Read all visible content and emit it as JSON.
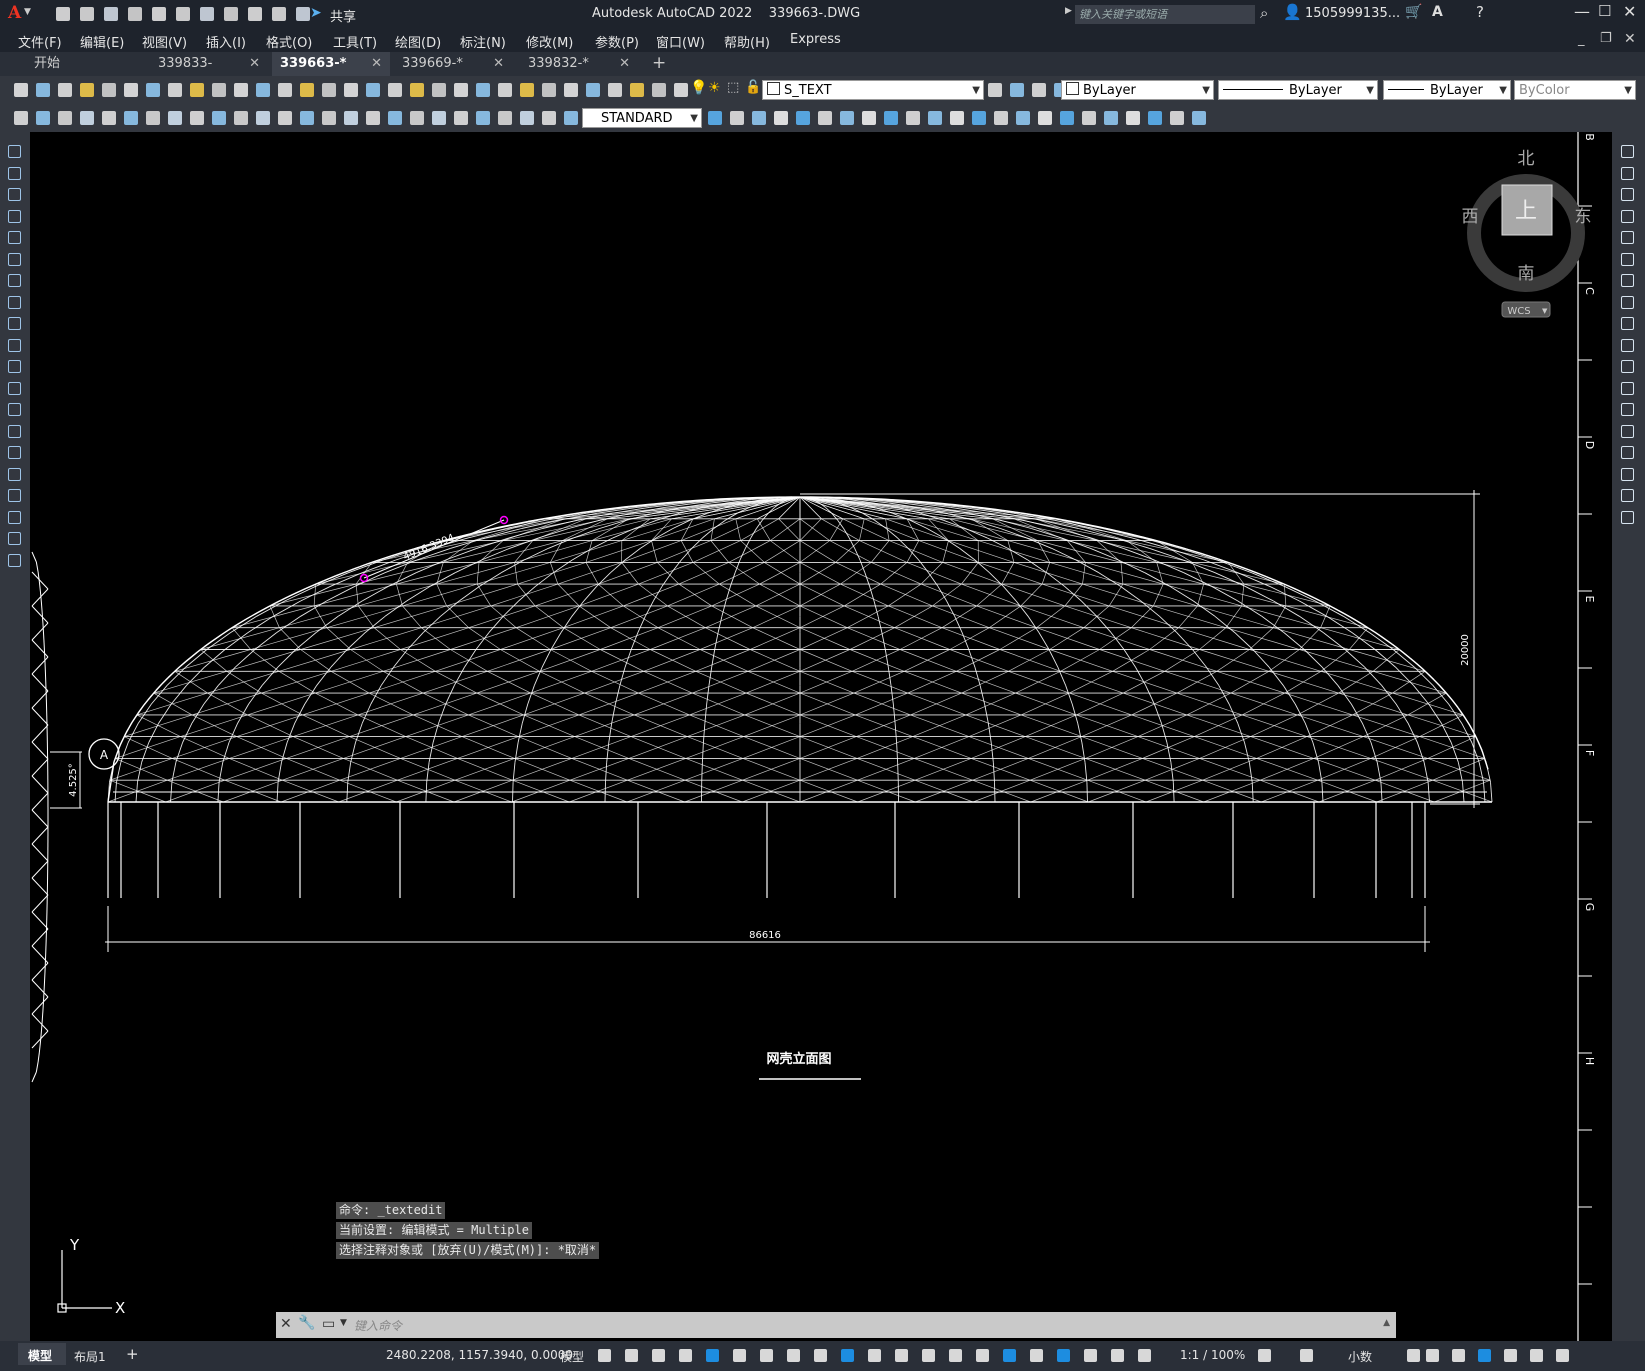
{
  "titlebar": {
    "app_logo": "A",
    "share_label": "共享",
    "title": "Autodesk AutoCAD 2022    339663-.DWG",
    "search_placeholder": "键入关键字或短语",
    "user": "1505999135...",
    "window_controls": [
      "minimize-icon",
      "restore-icon",
      "close-icon"
    ]
  },
  "menubar": {
    "items": [
      "文件(F)",
      "编辑(E)",
      "视图(V)",
      "插入(I)",
      "格式(O)",
      "工具(T)",
      "绘图(D)",
      "标注(N)",
      "修改(M)",
      "参数(P)",
      "窗口(W)",
      "帮助(H)",
      "Express"
    ]
  },
  "tabs": {
    "items": [
      {
        "label": "开始",
        "closable": false,
        "active": false
      },
      {
        "label": "339833-",
        "closable": true,
        "active": false
      },
      {
        "label": "339663-*",
        "closable": true,
        "active": true
      },
      {
        "label": "339669-*",
        "closable": true,
        "active": false
      },
      {
        "label": "339832-*",
        "closable": true,
        "active": false
      }
    ],
    "add_label": "+",
    "close_glyph": "✕"
  },
  "toolbar1": {
    "layer_name": "S_TEXT",
    "color_value": "ByLayer",
    "linetype_value": "ByLayer",
    "lineweight_value": "ByLayer",
    "plotstyle_value": "ByColor"
  },
  "toolbar2": {
    "textstyle_value": "STANDARD"
  },
  "viewcube": {
    "north": "北",
    "south": "南",
    "east": "东",
    "west": "西",
    "face": "上",
    "wcs": "WCS"
  },
  "drawing": {
    "top_dimension": "4916.3394",
    "height_dimension": "20000",
    "width_dimension": "86616",
    "angle_dimension": "4.525°",
    "grid_marker": "A",
    "caption": "网壳立面图",
    "ruler_labels": [
      "B",
      "C",
      "D",
      "E",
      "F",
      "G",
      "H"
    ],
    "ucs_x": "X",
    "ucs_y": "Y"
  },
  "command": {
    "history": [
      "命令: _textedit",
      "当前设置: 编辑模式 = Multiple",
      "选择注释对象或 [放弃(U)/模式(M)]: *取消*"
    ],
    "placeholder": "键入命令"
  },
  "status": {
    "layout_tabs": [
      "模型",
      "布局1"
    ],
    "add_layout": "+",
    "coords": "2480.2208, 1157.3940, 0.0000",
    "space": "模型",
    "scale": "1:1 / 100%",
    "units": "小数"
  },
  "colors": {
    "accent_blue": "#1d8de0",
    "background": "#000000",
    "grip": "#ff00ff"
  }
}
